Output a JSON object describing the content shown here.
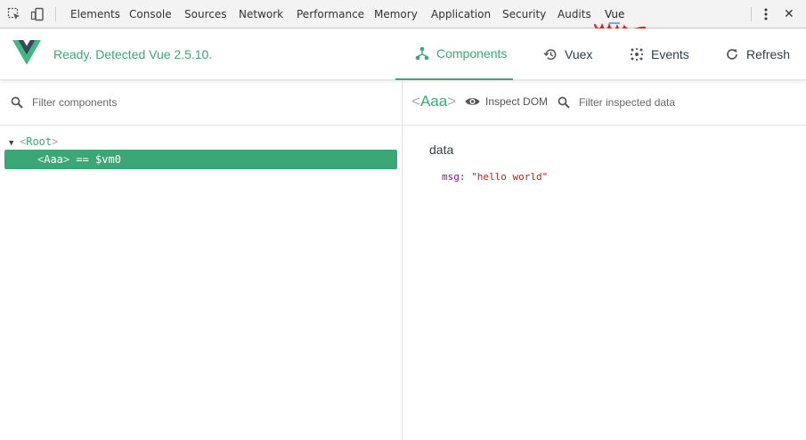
{
  "devtools": {
    "tabs": [
      "Elements",
      "Console",
      "Sources",
      "Network",
      "Performance",
      "Memory",
      "Application",
      "Security",
      "Audits",
      "Vue"
    ],
    "active_tab": "Vue",
    "icons": [
      "inspect-element-icon",
      "device-toolbar-icon",
      "more-vert-icon",
      "close-icon"
    ],
    "close_glyph": "✕"
  },
  "vue": {
    "status": "Ready. Detected Vue 2.5.10.",
    "nav": [
      {
        "label": "Components",
        "icon": "components-icon",
        "active": true
      },
      {
        "label": "Vuex",
        "icon": "history-icon",
        "active": false
      },
      {
        "label": "Events",
        "icon": "events-icon",
        "active": false
      },
      {
        "label": "Refresh",
        "icon": "refresh-icon",
        "active": false
      }
    ],
    "colors": {
      "accent": "#3ba776",
      "text": "#2c3e50"
    }
  },
  "left": {
    "filter_placeholder": "Filter components",
    "tree": {
      "root": {
        "open_bracket": "<",
        "name": "Root",
        "close_bracket": ">"
      },
      "selected": {
        "open_bracket": "<",
        "name": "Aaa",
        "close_bracket": ">",
        "suffix": " == $vm0"
      }
    }
  },
  "right": {
    "title": {
      "open_bracket": "<",
      "name": "Aaa",
      "close_bracket": ">"
    },
    "inspect_dom_label": "Inspect DOM",
    "filter_placeholder": "Filter inspected data",
    "data_heading": "data",
    "prop": {
      "key": "msg",
      "colon": ":",
      "value": "\"hello world\""
    }
  }
}
